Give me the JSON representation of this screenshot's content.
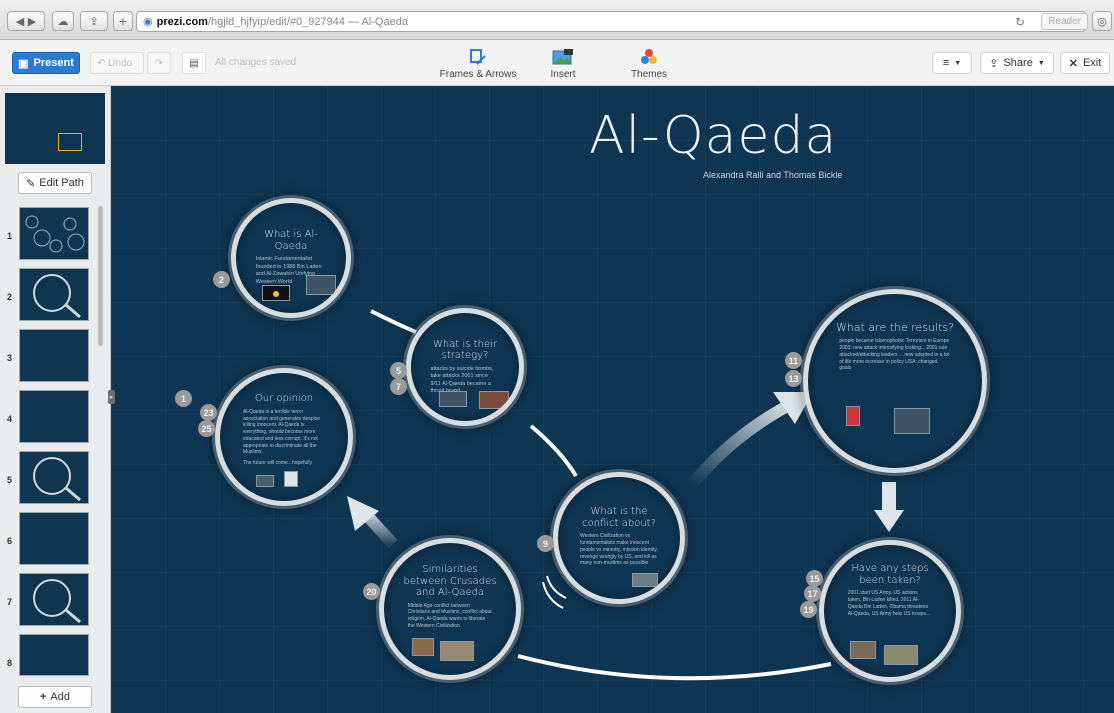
{
  "browser": {
    "url_host": "prezi.com",
    "url_path": "/hgjld_hjfyip/edit/#0_927944 — Al-Qaeda",
    "reader_label": "Reader"
  },
  "toolbar": {
    "present_label": "Present",
    "undo_label": "Undo",
    "saved_status": "All changes saved",
    "frames_label": "Frames & Arrows",
    "insert_label": "Insert",
    "themes_label": "Themes",
    "share_label": "Share",
    "exit_label": "Exit"
  },
  "sidebar": {
    "edit_path_label": "Edit Path",
    "add_label": "Add",
    "slides": [
      {
        "num": "1"
      },
      {
        "num": "2"
      },
      {
        "num": "3"
      },
      {
        "num": "4"
      },
      {
        "num": "5"
      },
      {
        "num": "6"
      },
      {
        "num": "7"
      },
      {
        "num": "8"
      }
    ]
  },
  "canvas": {
    "title": "Al-Qaeda",
    "authors": "Alexandra Ralli and Thomas Bickle",
    "frames": {
      "what_is": {
        "title": "What is Al-Qaeda",
        "body": "Islamic Fundamentalist founded in 1988 Bin Laden and Al-Zawahiri Unifying Western World"
      },
      "strategy": {
        "title": "What is their strategy?",
        "body": "attacks by suicide bombs, take attacks 2001 since 9/11 Al-Qaeda became a threat brand"
      },
      "opinion": {
        "title": "Our opinion",
        "body": "Al-Qaeda is a terrible terror association and generates despise killing innocent. Al-Qaeda is everything, should become more educated and less corrupt. It's not appropriate to discriminate all the Muslims.",
        "footer": "The future will come...hopefully"
      },
      "conflict": {
        "title": "What is the conflict about?",
        "body": "Western Civilization vs fundamentalists make innocent people vs minority, mission identity, revenge wrongly by US, and kill as many non-muslims as possible"
      },
      "results": {
        "title": "What are the results?",
        "body": "people became Islamophobic Terrorism in Europe 2003: new attack intensifying looking... 2001 rule attacked/attacking leaders ... new adopted in a lot of life more increase in policy USA: changed goals"
      },
      "similarities": {
        "title": "Similarities between Crusades and Al-Qaeda",
        "body": "Middle Age conflict between Christians and Muslims, conflict about religion, Al-Qaeda wants to liberate the Western Civilization"
      },
      "steps": {
        "title": "Have any steps been taken?",
        "body": "2001 start US Army, US actions taken, Bin Laden killed, 2011 Al-Qaeda Bin Laden, Obama threatens Al-Qaeda, US Army help US troops..."
      }
    },
    "badges": [
      "1",
      "2",
      "5",
      "7",
      "9",
      "11",
      "13",
      "15",
      "17",
      "19",
      "20",
      "23",
      "25"
    ]
  },
  "colors": {
    "canvas_bg": "#0e3552",
    "present_blue": "#2b7bd4",
    "badge_gray": "#9a9a9a"
  }
}
